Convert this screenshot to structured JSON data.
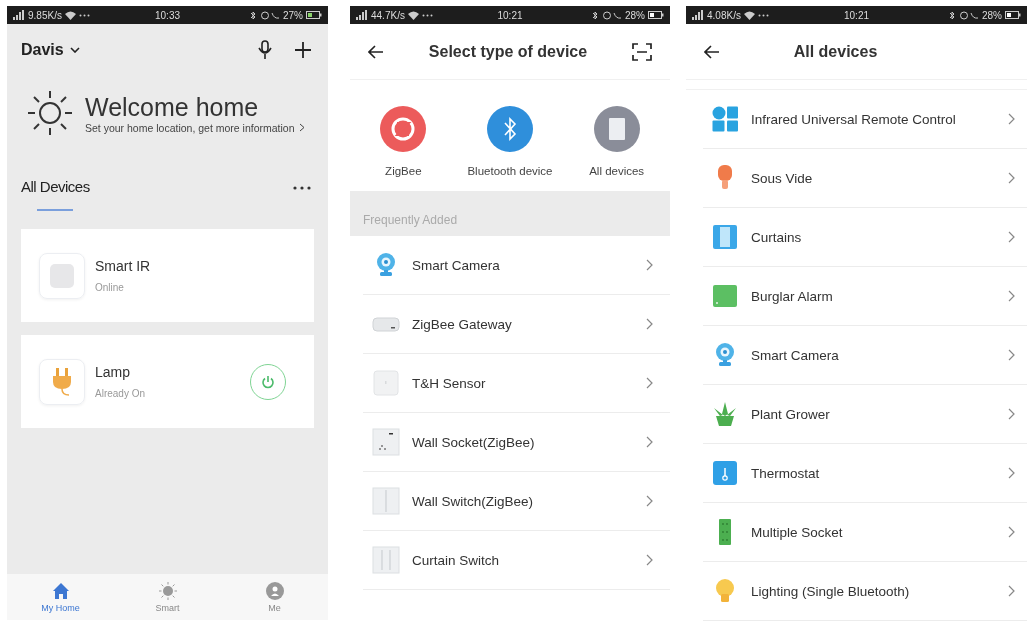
{
  "home_screen": {
    "status_bar": {
      "speed": "9.85K/s",
      "time": "10:33",
      "battery": "27%"
    },
    "home_name": "Davis",
    "welcome": {
      "title": "Welcome home",
      "subtitle": "Set your home location, get more information"
    },
    "section_title": "All Devices",
    "devices": [
      {
        "name": "Smart IR",
        "status": "Online",
        "kind": "ir"
      },
      {
        "name": "Lamp",
        "status": "Already On",
        "kind": "plug",
        "on": true
      }
    ],
    "nav": [
      {
        "label": "My Home",
        "kind": "home",
        "selected": true
      },
      {
        "label": "Smart",
        "kind": "sun",
        "selected": false
      },
      {
        "label": "Me",
        "kind": "person",
        "selected": false
      }
    ]
  },
  "select_type_screen": {
    "status_bar": {
      "speed": "44.7K/s",
      "time": "10:21",
      "battery": "28%"
    },
    "title": "Select type of device",
    "categories": [
      {
        "label": "ZigBee",
        "kind": "zigbee"
      },
      {
        "label": "Bluetooth device",
        "kind": "bluetooth"
      },
      {
        "label": "All devices",
        "kind": "all"
      }
    ],
    "section_title": "Frequently Added",
    "items": [
      {
        "label": "Smart Camera",
        "kind": "camera"
      },
      {
        "label": "ZigBee Gateway",
        "kind": "gateway"
      },
      {
        "label": "T&H Sensor",
        "kind": "sensor"
      },
      {
        "label": "Wall Socket(ZigBee)",
        "kind": "socket"
      },
      {
        "label": "Wall Switch(ZigBee)",
        "kind": "switch"
      },
      {
        "label": "Curtain Switch",
        "kind": "curtain_switch"
      }
    ]
  },
  "all_devices_screen": {
    "status_bar": {
      "speed": "4.08K/s",
      "time": "10:21",
      "battery": "28%"
    },
    "title": "All devices",
    "items": [
      {
        "label": "Infrared Universal Remote Control",
        "kind": "remote"
      },
      {
        "label": "Sous Vide",
        "kind": "sous_vide"
      },
      {
        "label": "Curtains",
        "kind": "curtains"
      },
      {
        "label": "Burglar Alarm",
        "kind": "alarm"
      },
      {
        "label": "Smart Camera",
        "kind": "camera"
      },
      {
        "label": "Plant Grower",
        "kind": "plant"
      },
      {
        "label": "Thermostat",
        "kind": "thermostat"
      },
      {
        "label": "Multiple Socket",
        "kind": "multi_socket"
      },
      {
        "label": "Lighting (Single Bluetooth)",
        "kind": "bulb"
      }
    ]
  }
}
